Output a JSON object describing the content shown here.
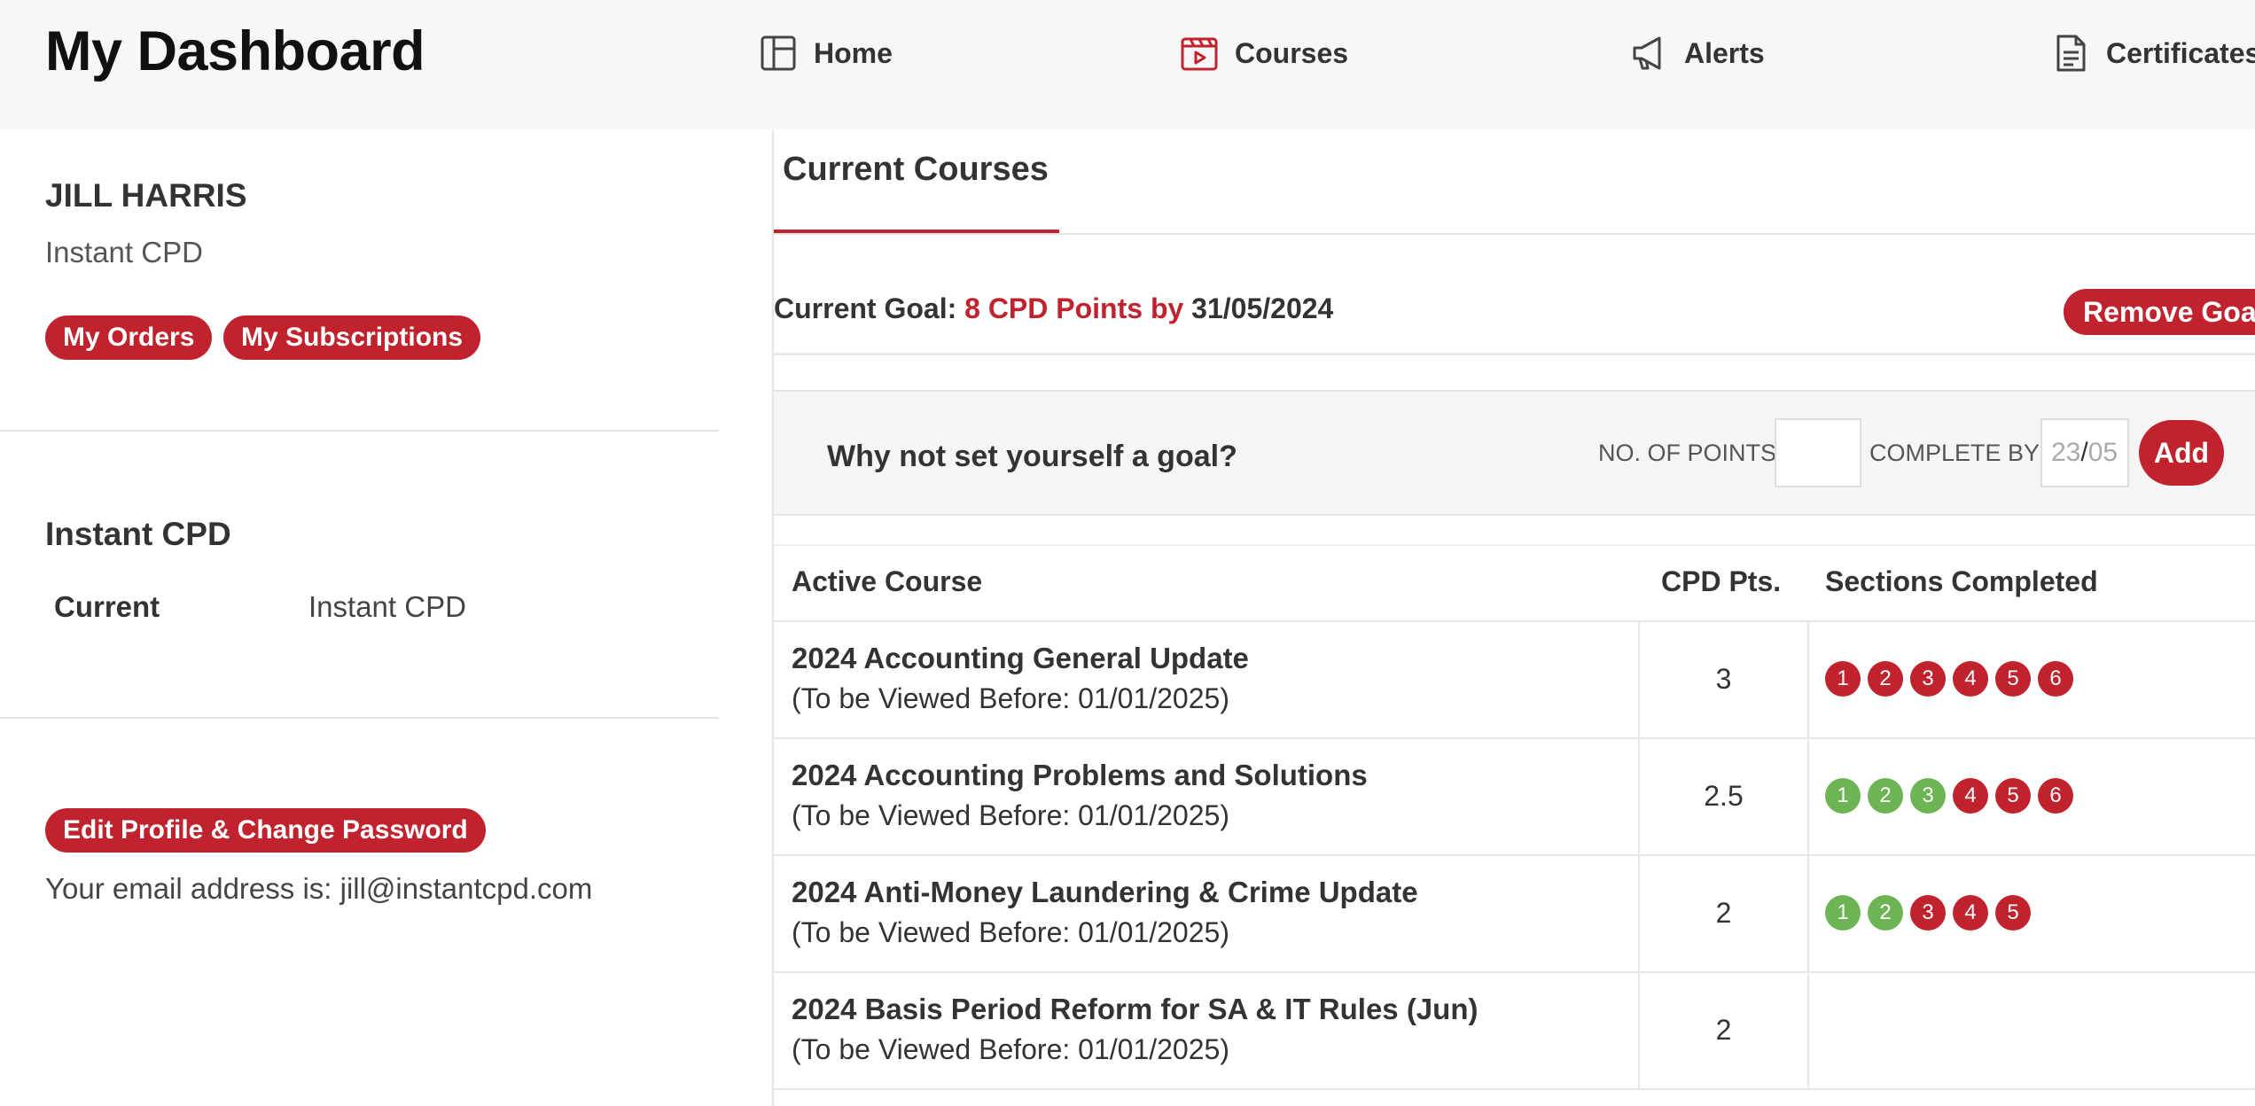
{
  "header": {
    "title": "My Dashboard",
    "nav": [
      {
        "label": "Home",
        "icon": "home-icon"
      },
      {
        "label": "Courses",
        "icon": "courses-icon"
      },
      {
        "label": "Alerts",
        "icon": "megaphone-icon"
      },
      {
        "label": "Certificates",
        "icon": "document-icon"
      }
    ]
  },
  "profile": {
    "name": "JILL HARRIS",
    "organisation": "Instant CPD",
    "orders_label": "My Orders",
    "subscriptions_label": "My Subscriptions"
  },
  "organisation_section": {
    "heading": "Instant CPD",
    "current_label": "Current",
    "current_value": "Instant CPD"
  },
  "account": {
    "edit_label": "Edit Profile & Change Password",
    "email_text": "Your email address is: jill@instantcpd.com"
  },
  "main": {
    "tab_label": "Current Courses",
    "goal": {
      "prefix": "Current Goal: ",
      "points_text": "8 CPD Points by",
      "date": " 31/05/2024",
      "remove_label": "Remove Goal"
    },
    "set_goal": {
      "question": "Why not set yourself a goal?",
      "points_label": "NO. OF POINTS",
      "points_value": "",
      "complete_label": "COMPLETE BY:",
      "date_day": "23",
      "date_sep": "/",
      "date_month": "05",
      "add_label": "Add"
    },
    "table": {
      "headers": {
        "course": "Active Course",
        "points": "CPD Pts.",
        "sections": "Sections Completed"
      },
      "rows": [
        {
          "name": "2024 Accounting General Update",
          "sub": "(To be Viewed Before: 01/01/2025)",
          "points": "3",
          "sections_total": 6,
          "sections_completed": 0
        },
        {
          "name": "2024 Accounting Problems and Solutions",
          "sub": "(To be Viewed Before: 01/01/2025)",
          "points": "2.5",
          "sections_total": 6,
          "sections_completed": 3
        },
        {
          "name": "2024 Anti-Money Laundering & Crime Update",
          "sub": "(To be Viewed Before: 01/01/2025)",
          "points": "2",
          "sections_total": 5,
          "sections_completed": 2
        },
        {
          "name": "2024 Basis Period Reform for SA & IT Rules (Jun)",
          "sub": "(To be Viewed Before: 01/01/2025)",
          "points": "2",
          "sections_total": 0,
          "sections_completed": 0
        }
      ]
    }
  },
  "colors": {
    "accent": "#c0232e",
    "completed": "#6db455",
    "topbar": "#f7f7f7"
  }
}
